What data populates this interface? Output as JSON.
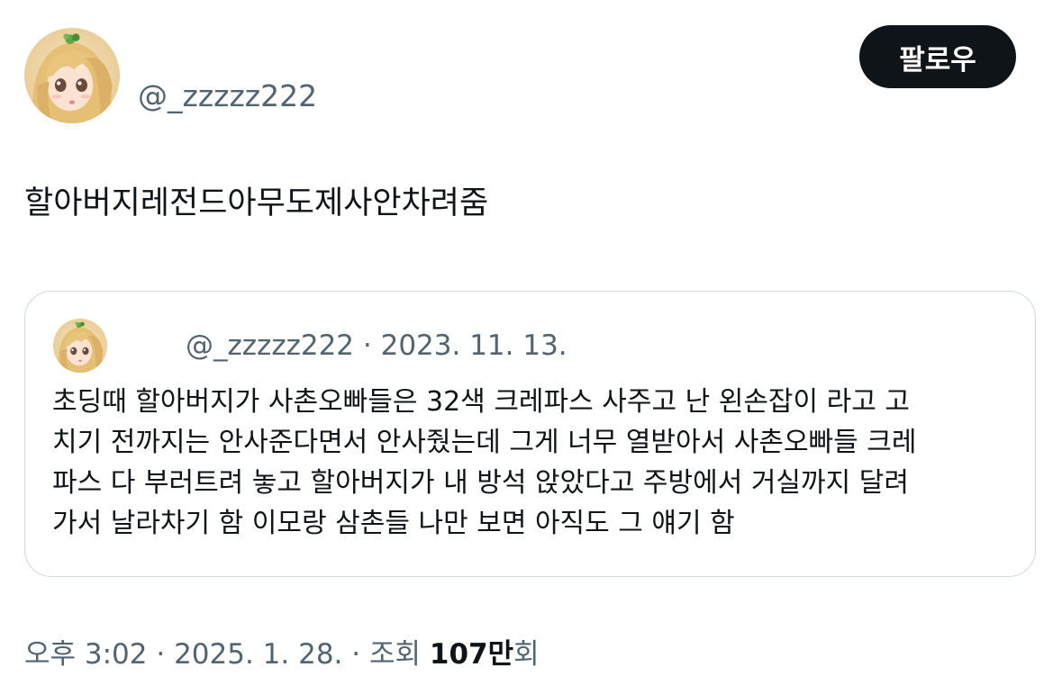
{
  "author": {
    "handle": "@_zzzzz222"
  },
  "follow_button": {
    "label": "팔로우"
  },
  "tweet": {
    "text": "할아버지레전드아무도제사안차려줌"
  },
  "quoted_tweet": {
    "handle": "@_zzzzz222",
    "separator": " · ",
    "date": "2023. 11. 13.",
    "text_lines": [
      "초딩때 할아버지가 사촌오빠들은 32색 크레파스 사주고 난 왼손잡이 라고 고",
      "치기 전까지는 안사준다면서 안사줬는데 그게 너무 열받아서 사촌오빠들 크레",
      "파스 다 부러트려 놓고 할아버지가 내 방석 앉았다고 주방에서 거실까지 달려",
      "가서 날라차기 함 이모랑 삼촌들 나만 보면 아직도 그 얘기 함"
    ]
  },
  "footer": {
    "time": "오후 3:02",
    "separator": " · ",
    "date": "2025. 1. 28.",
    "views_label": "조회 ",
    "views_number": "107만",
    "views_suffix": "회"
  },
  "colors": {
    "text_primary": "#0f1419",
    "text_secondary": "#536471",
    "border": "#cfd9de",
    "button_bg": "#0f1419",
    "button_text": "#ffffff"
  },
  "icons": {
    "avatar": "profile-avatar-anime-girl",
    "quote_avatar": "profile-avatar-anime-girl"
  }
}
